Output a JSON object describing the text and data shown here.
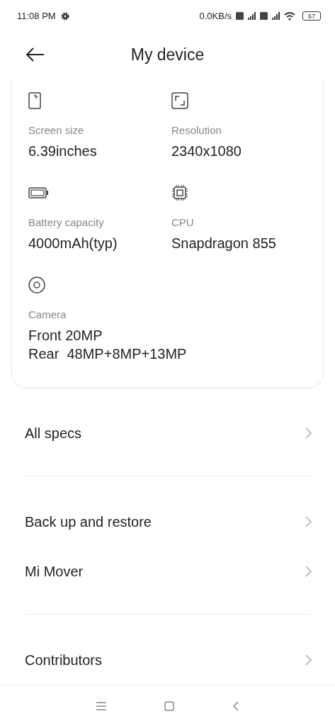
{
  "status_bar": {
    "time": "11:08 PM",
    "speed": "0.0KB/s",
    "battery": "67"
  },
  "header": {
    "title": "My device"
  },
  "specs": [
    {
      "kind": "screen",
      "label": "Screen size",
      "value": "6.39inches"
    },
    {
      "kind": "resolution",
      "label": "Resolution",
      "value": "2340x1080"
    },
    {
      "kind": "battery",
      "label": "Battery capacity",
      "value": "4000mAh(typ)"
    },
    {
      "kind": "cpu",
      "label": "CPU",
      "value": "Snapdragon 855"
    },
    {
      "kind": "camera",
      "label": "Camera",
      "value": "Front 20MP\nRear  48MP+8MP+13MP"
    }
  ],
  "menu_groups": [
    [
      {
        "label": "All specs"
      }
    ],
    [
      {
        "label": "Back up and restore"
      },
      {
        "label": "Mi Mover"
      }
    ],
    [
      {
        "label": "Contributors"
      }
    ]
  ]
}
